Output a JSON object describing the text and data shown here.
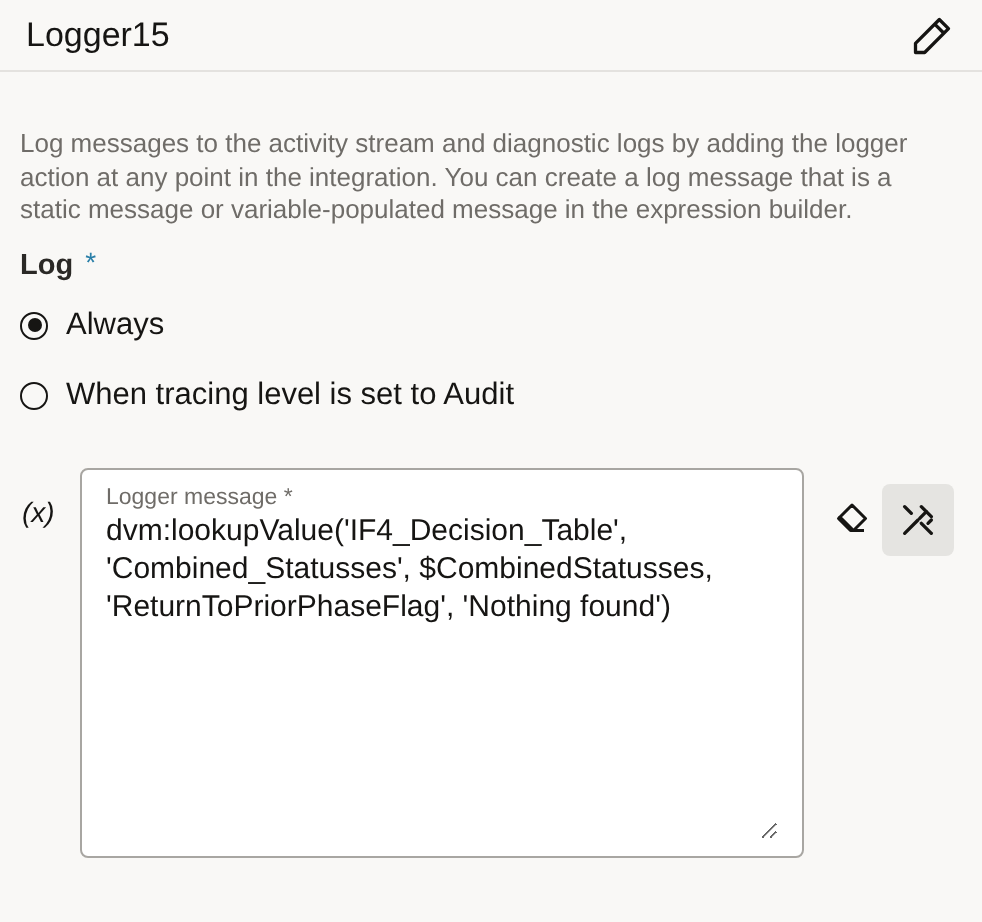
{
  "header": {
    "title": "Logger15"
  },
  "description": "Log messages to the activity stream and diagnostic logs by adding the logger action at any point in the integration. You can create a log message that is a static message or variable-populated message in the expression builder.",
  "log": {
    "label": "Log",
    "required_mark": "*",
    "options": [
      {
        "label": "Always",
        "selected": true
      },
      {
        "label": "When tracing level is set to Audit",
        "selected": false
      }
    ]
  },
  "message": {
    "variable_toggle": "(x)",
    "label": "Logger message *",
    "value": "dvm:lookupValue('IF4_Decision_Table', 'Combined_Statusses', $CombinedStatusses, 'ReturnToPriorPhaseFlag', 'Nothing found')"
  }
}
